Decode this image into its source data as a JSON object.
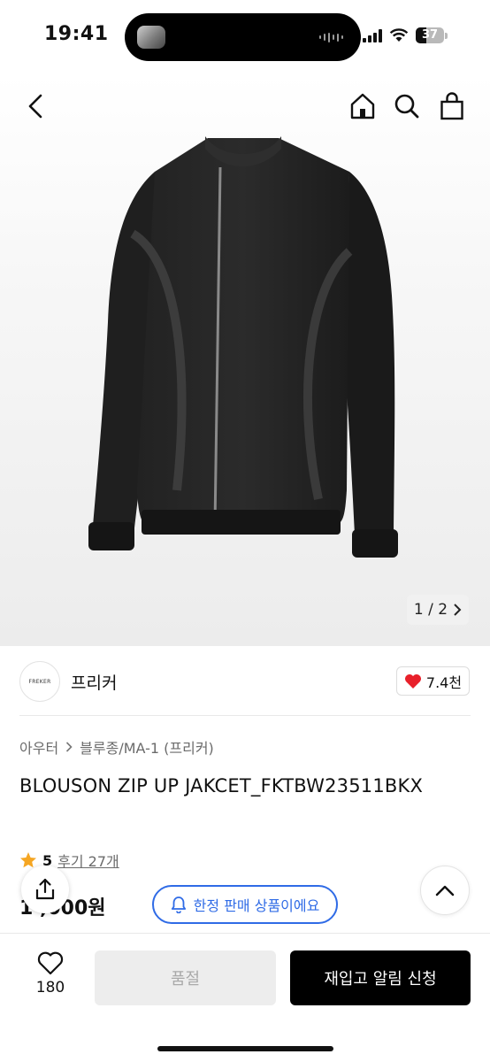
{
  "status_bar": {
    "time": "19:41",
    "battery": "37"
  },
  "header": {
    "icons": [
      "chevron-left-icon",
      "home-icon",
      "search-icon",
      "shopping-bag-icon"
    ]
  },
  "gallery": {
    "counter": "1 / 2"
  },
  "brand": {
    "logo_text": "FREKER",
    "name": "프리커",
    "likes": "7.4천"
  },
  "breadcrumb": {
    "level1": "아우터",
    "level2": "블루종/MA-1 (프리커)"
  },
  "product": {
    "title": "BLOUSON ZIP UP JAKCET_FKTBW23511BKX",
    "rating": "5",
    "review_label": "후기 27개",
    "price": "1  ,000원",
    "limited_badge": "한정 판매 상품이에요"
  },
  "bottom_bar": {
    "wish_count": "180",
    "soldout_label": "품절",
    "restock_label": "재입고 알림 신청"
  },
  "colors": {
    "accent_blue": "#2f6be6",
    "heart_red": "#e8202a",
    "star_orange": "#f5a623",
    "primary_black": "#000000"
  }
}
